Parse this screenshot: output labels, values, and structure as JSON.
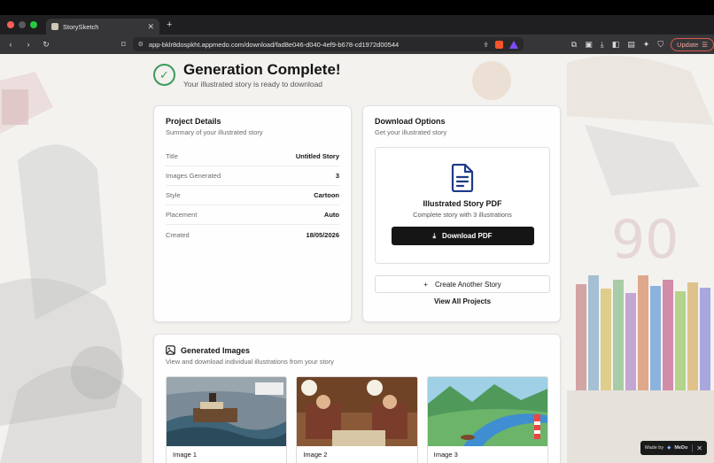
{
  "browser": {
    "tab_title": "StorySketch",
    "url": "app-bklr8dospkht.appmedo.com/download/fad8e046-d040-4ef9-b678-cd1972d00544",
    "update_label": "Update"
  },
  "header": {
    "title": "Generation Complete!",
    "subtitle": "Your illustrated story is ready to download"
  },
  "project_details": {
    "title": "Project Details",
    "subtitle": "Summary of your illustrated story",
    "rows": [
      {
        "label": "Title",
        "value": "Untitled Story"
      },
      {
        "label": "Images Generated",
        "value": "3"
      },
      {
        "label": "Style",
        "value": "Cartoon"
      },
      {
        "label": "Placement",
        "value": "Auto"
      },
      {
        "label": "Created",
        "value": "18/05/2026"
      }
    ]
  },
  "download_options": {
    "title": "Download Options",
    "subtitle": "Get your illustrated story",
    "pdf_title": "Illustrated Story PDF",
    "pdf_subtitle": "Complete story with 3 illustrations",
    "pdf_button": "Download PDF",
    "another_button": "Create Another Story",
    "view_all": "View All Projects"
  },
  "generated_images": {
    "title": "Generated Images",
    "subtitle": "View and download individual illustrations from your story",
    "images": [
      {
        "label": "Image 1"
      },
      {
        "label": "Image 2"
      },
      {
        "label": "Image 3"
      }
    ]
  },
  "badge": {
    "made_by": "Made by",
    "brand": "MeDo"
  },
  "colors": {
    "success": "#3d9a5b",
    "primary_button": "#151515",
    "accent_icon": "#1e3a8a"
  }
}
